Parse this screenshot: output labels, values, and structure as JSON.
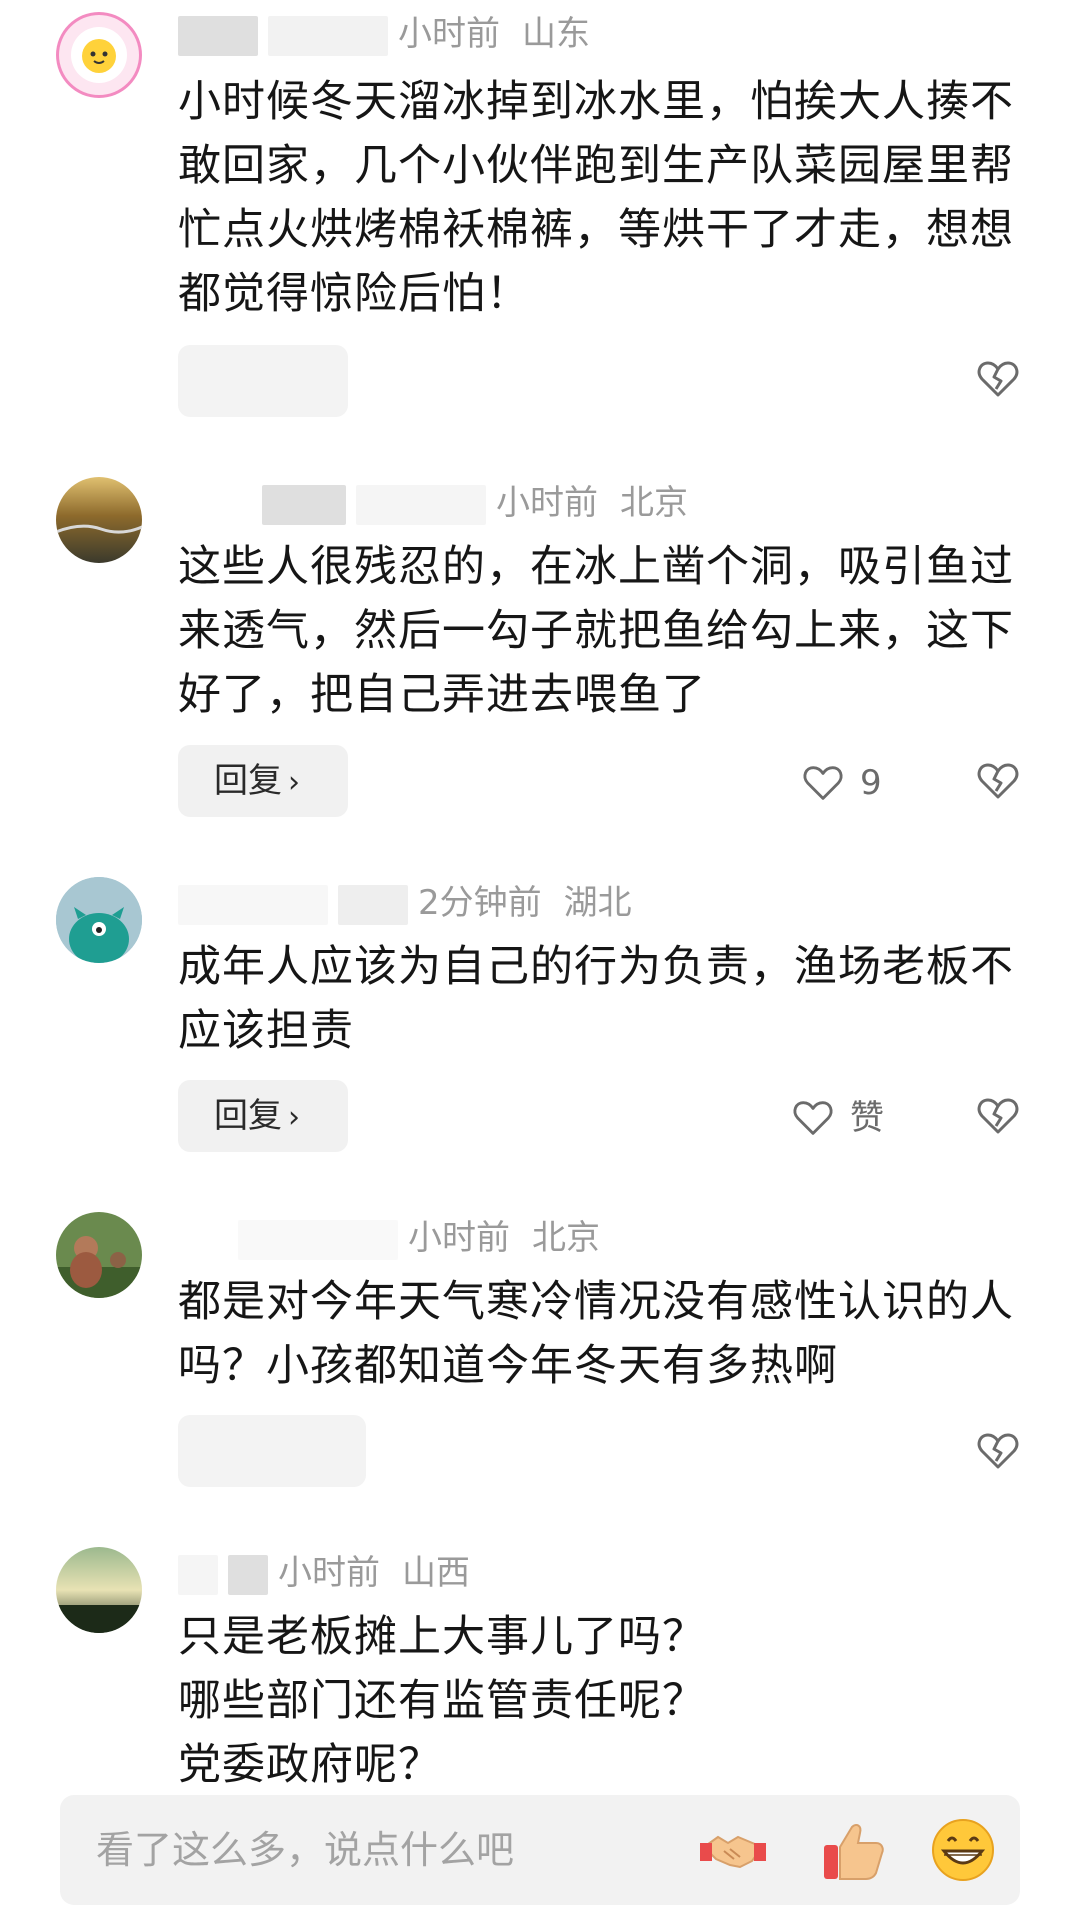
{
  "comments": [
    {
      "time": "小时前",
      "location": "山东",
      "text": "小时候冬天溜冰掉到冰水里，怕挨大人揍不敢回家，几个小伙伴跑到生产队菜园屋里帮忙点火烘烤棉袄棉裤，等烘干了才走，想想都觉得惊险后怕！"
    },
    {
      "time": "小时前",
      "location": "北京",
      "text": "这些人很残忍的，在冰上凿个洞，吸引鱼过来透气，然后一勾子就把鱼给勾上来，这下好了，把自己弄进去喂鱼了",
      "reply_label": "回复",
      "like_count": "9"
    },
    {
      "time": "2分钟前",
      "location": "湖北",
      "text": "成年人应该为自己的行为负责，渔场老板不应该担责",
      "reply_label": "回复",
      "like_label": "赞"
    },
    {
      "time": "小时前",
      "location": "北京",
      "text": "都是对今年天气寒冷情况没有感性认识的人吗？小孩都知道今年冬天有多热啊"
    },
    {
      "time": "小时前",
      "location": "山西",
      "text_lines": [
        "只是老板摊上大事儿了吗？",
        "哪些部门还有监管责任呢？",
        "党委政府呢？"
      ]
    }
  ],
  "input": {
    "placeholder": "看了这么多，说点什么吧"
  },
  "quick_reactions": [
    "handshake-emoji",
    "thumbs-up-emoji",
    "grinning-emoji"
  ],
  "colors": {
    "meta_gray": "#9a9a9a",
    "reply_bg": "#f1f1f1",
    "avatar_pink": "#f38bc1"
  }
}
